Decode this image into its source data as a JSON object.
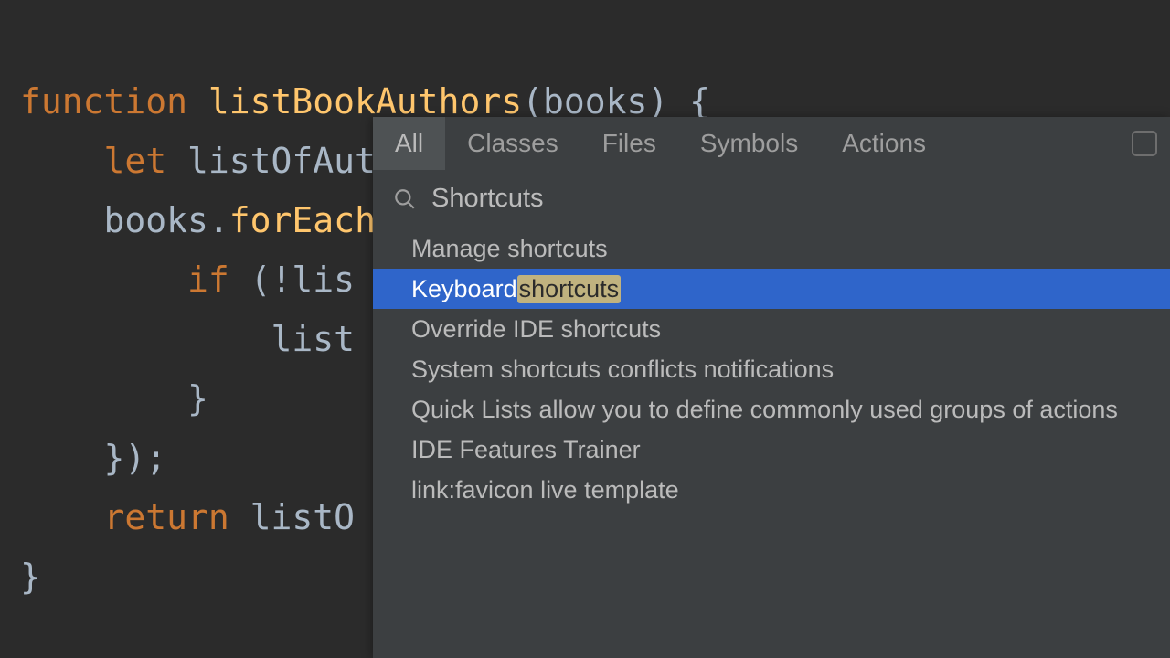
{
  "code": {
    "line1": {
      "kw": "function ",
      "fn": "listBookAuthors",
      "rest": "(books) {"
    },
    "line2": {
      "indent": "    ",
      "kw": "let ",
      "rest": "listOfAuthors = [];"
    },
    "line3": {
      "indent": "    ",
      "plain": "books.",
      "fn": "forEach",
      "rest": "("
    },
    "line4": {
      "indent": "        ",
      "kw": "if ",
      "rest": "(!lis"
    },
    "line5": {
      "indent": "            ",
      "rest": "list"
    },
    "line6": {
      "indent": "        ",
      "rest": "}"
    },
    "line7": {
      "indent": "    ",
      "rest": "});"
    },
    "line8": {
      "indent": "    ",
      "kw": "return ",
      "rest": "listO"
    },
    "line9": {
      "rest": "}"
    }
  },
  "popup": {
    "tabs": {
      "all": "All",
      "classes": "Classes",
      "files": "Files",
      "symbols": "Symbols",
      "actions": "Actions"
    },
    "search_value": "Shortcuts",
    "results": [
      {
        "text": "Manage shortcuts"
      },
      {
        "prefix": "Keyboard ",
        "highlight": "shortcuts"
      },
      {
        "text": "Override IDE shortcuts"
      },
      {
        "text": "System shortcuts conflicts notifications"
      },
      {
        "text": "Quick Lists allow you to define commonly used groups of actions"
      },
      {
        "text": "IDE Features Trainer"
      },
      {
        "text": "link:favicon live template"
      }
    ]
  }
}
